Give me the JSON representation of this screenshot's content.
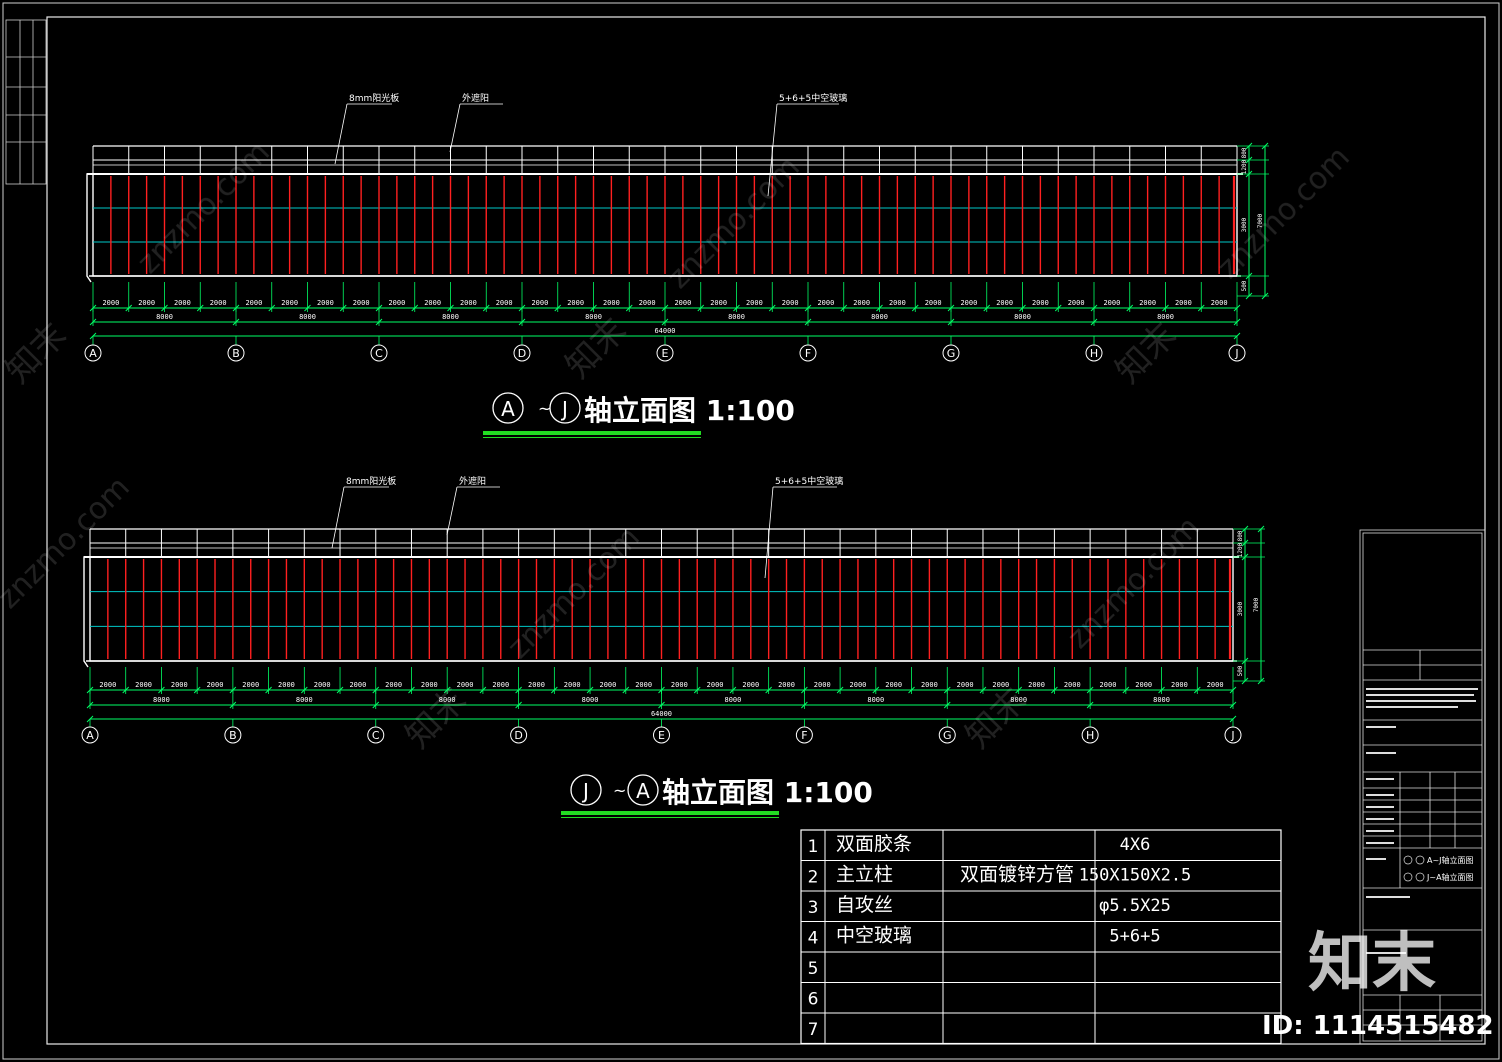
{
  "elevations": [
    {
      "title_axes": [
        "A",
        "J"
      ],
      "title_text": "轴立面图 1:100",
      "callouts": [
        "8mm阳光板",
        "外遮阳",
        "5+6+5中空玻璃"
      ],
      "axes": [
        "A",
        "B",
        "C",
        "D",
        "E",
        "F",
        "G",
        "H",
        "J"
      ],
      "module_dims": [
        "2000",
        "2000",
        "2000",
        "2000",
        "2000",
        "2000",
        "2000",
        "2000",
        "2000",
        "2000",
        "2000",
        "2000",
        "2000",
        "2000",
        "2000",
        "2000",
        "2000",
        "2000",
        "2000",
        "2000",
        "2000",
        "2000",
        "2000",
        "2000",
        "2000",
        "2000",
        "2000",
        "2000",
        "2000",
        "2000",
        "2000",
        "2000"
      ],
      "bay_dims": [
        "8000",
        "8000",
        "8000",
        "8000",
        "8000",
        "8000",
        "8000",
        "8000"
      ],
      "total_dim": "64000",
      "height_dims": [
        "800",
        "1200",
        "3000",
        "500"
      ],
      "total_height": "7000"
    },
    {
      "title_axes": [
        "J",
        "A"
      ],
      "title_text": "轴立面图 1:100",
      "callouts": [
        "8mm阳光板",
        "外遮阳",
        "5+6+5中空玻璃"
      ],
      "axes": [
        "A",
        "B",
        "C",
        "D",
        "E",
        "F",
        "G",
        "H",
        "J"
      ],
      "module_dims": [
        "2000",
        "2000",
        "2000",
        "2000",
        "2000",
        "2000",
        "2000",
        "2000",
        "2000",
        "2000",
        "2000",
        "2000",
        "2000",
        "2000",
        "2000",
        "2000",
        "2000",
        "2000",
        "2000",
        "2000",
        "2000",
        "2000",
        "2000",
        "2000",
        "2000",
        "2000",
        "2000",
        "2000",
        "2000",
        "2000",
        "2000",
        "2000"
      ],
      "bay_dims": [
        "8000",
        "8000",
        "8000",
        "8000",
        "8000",
        "8000",
        "8000",
        "8000"
      ],
      "total_dim": "64000",
      "height_dims": [
        "800",
        "1200",
        "3000",
        "500"
      ],
      "total_height": "7000"
    }
  ],
  "material_table": {
    "rows": [
      {
        "no": "1",
        "name": "双面胶条",
        "spec": "",
        "size": "4X6"
      },
      {
        "no": "2",
        "name": "主立柱",
        "spec": "双面镀锌方管",
        "size": "150X150X2.5"
      },
      {
        "no": "3",
        "name": "自攻丝",
        "spec": "",
        "size": "φ5.5X25"
      },
      {
        "no": "4",
        "name": "中空玻璃",
        "spec": "",
        "size": "5+6+5"
      },
      {
        "no": "5",
        "name": "",
        "spec": "",
        "size": ""
      },
      {
        "no": "6",
        "name": "",
        "spec": "",
        "size": ""
      },
      {
        "no": "7",
        "name": "",
        "spec": "",
        "size": ""
      }
    ]
  },
  "title_block": {
    "drawing_names": [
      "A~J轴立面图",
      "J~A轴立面图"
    ]
  },
  "watermark": {
    "brand": "知末",
    "site": "znzmo.com",
    "id_label": "ID: 1114515482"
  },
  "colors": {
    "frame": "#ffffff",
    "mullion": "#ff2020",
    "transom": "#00c8c8",
    "dimension": "#00ff66",
    "title_underline": "#22dd22",
    "background": "#000000"
  }
}
